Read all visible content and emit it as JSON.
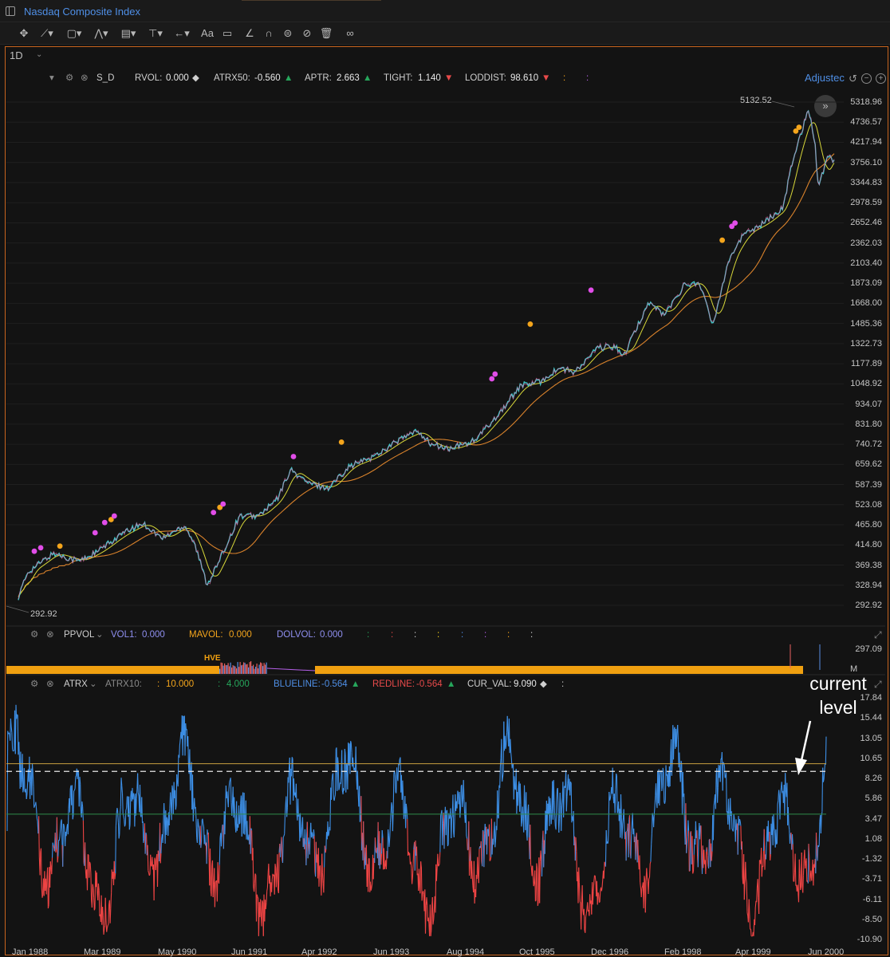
{
  "window": {
    "title": "Nasdaq Composite Index"
  },
  "toolbar": {
    "text_tool": "Aa"
  },
  "interval": {
    "value": "1D"
  },
  "price_legend": {
    "indicator": "S_D",
    "items": [
      {
        "name": "RVOL:",
        "value": "0.000",
        "arrow": "◆",
        "arrow_color": "#cfcfcf"
      },
      {
        "name": "ATRX50:",
        "value": "-0.560",
        "arrow": "▲",
        "arrow_color": "#26a65b"
      },
      {
        "name": "APTR:",
        "value": "2.663",
        "arrow": "▲",
        "arrow_color": "#26a65b"
      },
      {
        "name": "TIGHT:",
        "value": "1.140",
        "arrow": "▼",
        "arrow_color": "#e84a4a"
      },
      {
        "name": "LODDIST:",
        "value": "98.610",
        "arrow": "▼",
        "arrow_color": "#e84a4a"
      }
    ],
    "extra_colons": [
      ":",
      ":"
    ],
    "adjusted_label": "Adjustec"
  },
  "price_axis": [
    "5318.96",
    "4736.57",
    "4217.94",
    "3756.10",
    "3344.83",
    "2978.59",
    "2652.46",
    "2362.03",
    "2103.40",
    "1873.09",
    "1668.00",
    "1485.36",
    "1322.73",
    "1177.89",
    "1048.92",
    "934.07",
    "831.80",
    "740.72",
    "659.62",
    "587.39",
    "523.08",
    "465.80",
    "414.80",
    "369.38",
    "328.94",
    "292.92"
  ],
  "price_high_label": "5132.52",
  "price_low_label": "292.92",
  "volume_legend": {
    "indicator": "PPVOL",
    "vol1_label": "VOL1:",
    "vol1_value": "0.000",
    "mavol_label": "MAVOL:",
    "mavol_value": "0.000",
    "dolvol_label": "DOLVOL:",
    "dolvol_value": "0.000",
    "trailing": [
      ":",
      ":",
      ":",
      ":",
      ":",
      ":",
      ":",
      ":"
    ]
  },
  "volume_axis": {
    "top": "297.09",
    "unit": "M"
  },
  "volume_marker": "HVE",
  "atrx_legend": {
    "indicator": "ATRX",
    "atrx10_label": "ATRX10:",
    "orange_colon": ":",
    "orange_value": "10.000",
    "green_colon": ":",
    "green_value": "4.000",
    "blueline_label": "BLUELINE:",
    "blueline_value": "-0.564",
    "redline_label": "REDLINE:",
    "redline_value": "-0.564",
    "curval_label": "CUR_VAL:",
    "curval_value": "9.090",
    "trailing_colon": ":"
  },
  "atrx_axis": [
    "17.84",
    "15.44",
    "13.05",
    "10.65",
    "8.26",
    "5.86",
    "3.47",
    "1.08",
    "-1.32",
    "-3.71",
    "-6.11",
    "-8.50",
    "-10.90"
  ],
  "atrx_lines": {
    "orange_level": 10.0,
    "green_level": 4.0,
    "current_level": 9.09
  },
  "x_axis": [
    "Jan 1988",
    "Mar 1989",
    "May 1990",
    "Jun 1991",
    "Apr 1992",
    "Jun 1993",
    "Aug 1994",
    "Oct 1995",
    "Dec 1996",
    "Feb 1998",
    "Apr 1999",
    "Jun 2000"
  ],
  "annotation": {
    "line1": "current",
    "line2": "level"
  },
  "colors": {
    "accent_blue": "#4f8fe6",
    "frame_orange": "#c8641e",
    "ma_orange": "#d9822b",
    "ma_yellow": "#d8d83a",
    "dot_magenta": "#e14de8",
    "dot_orange": "#f4a51c",
    "atrx_blue": "#3d8fe6",
    "atrx_red": "#ee4444",
    "volume_bar": "#f0a010"
  }
}
